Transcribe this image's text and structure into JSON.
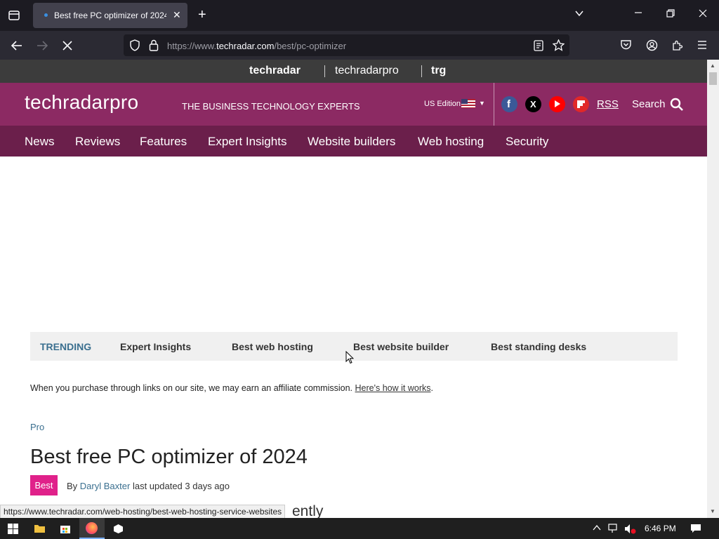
{
  "browser": {
    "tab_title": "Best free PC optimizer of 2024 |",
    "url_prefix": "https://www.",
    "url_domain": "techradar.com",
    "url_path": "/best/pc-optimizer",
    "status_url": "https://www.techradar.com/web-hosting/best-web-hosting-service-websites"
  },
  "brand_strip": {
    "brand1": "techradar",
    "brand2": "techradarpro",
    "brand3": "trg"
  },
  "header": {
    "logo": "techradarpro",
    "tagline": "THE BUSINESS TECHNOLOGY EXPERTS",
    "edition": "US Edition",
    "rss": "RSS",
    "search": "Search"
  },
  "menu": [
    "News",
    "Reviews",
    "Features",
    "Expert Insights",
    "Website builders",
    "Web hosting",
    "Security"
  ],
  "trending": {
    "label": "TRENDING",
    "items": [
      "Expert Insights",
      "Best web hosting",
      "Best website builder",
      "Best standing desks"
    ]
  },
  "article": {
    "affiliate_text": "When you purchase through links on our site, we may earn an affiliate commission.",
    "affiliate_link": "Here's how it works",
    "category": "Pro",
    "title": "Best free PC optimizer of 2024",
    "badge": "Best",
    "by": "By",
    "author": "Daryl Baxter",
    "updated": "last updated 3 days ago",
    "partial_text": "ently"
  },
  "taskbar": {
    "time": "6:46 PM"
  },
  "colors": {
    "header_bg": "#8c2a63",
    "menu_bg": "#6b1f4b",
    "accent_pink": "#e0218a",
    "link_blue": "#3a6f8f"
  }
}
